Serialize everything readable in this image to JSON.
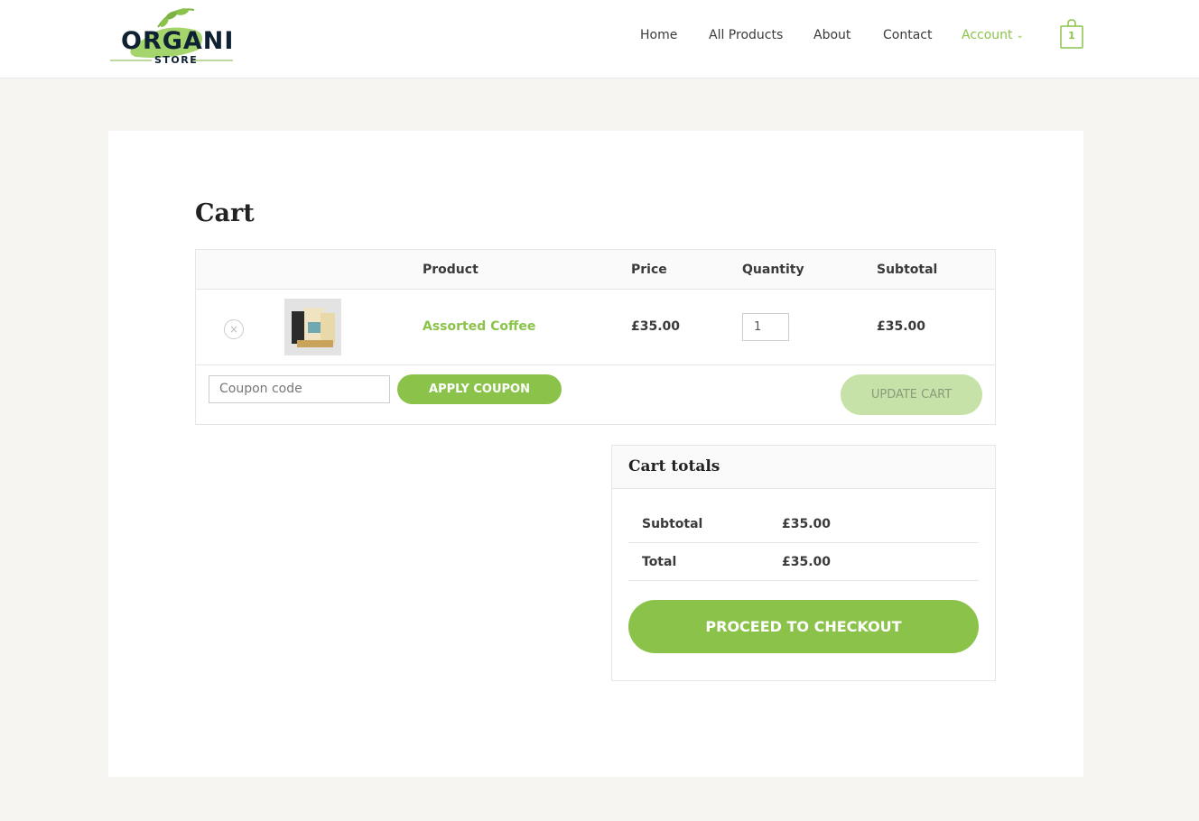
{
  "logo": {
    "top_text": "ORGANIC",
    "bottom_text": "STORE"
  },
  "nav": {
    "items": [
      {
        "label": "Home"
      },
      {
        "label": "All Products"
      },
      {
        "label": "About"
      },
      {
        "label": "Contact"
      },
      {
        "label": "Account",
        "active": true
      }
    ],
    "cart_count": "1"
  },
  "page": {
    "title": "Cart"
  },
  "cart_table": {
    "headers": [
      "Product",
      "Price",
      "Quantity",
      "Subtotal"
    ],
    "rows": [
      {
        "remove_icon": "×",
        "product_name": "Assorted Coffee",
        "price": "£35.00",
        "quantity": "1",
        "subtotal": "£35.00"
      }
    ],
    "coupon_placeholder": "Coupon code",
    "apply_coupon_label": "APPLY COUPON",
    "update_cart_label": "UPDATE CART"
  },
  "cart_totals": {
    "title": "Cart totals",
    "rows": [
      {
        "label": "Subtotal",
        "value": "£35.00"
      },
      {
        "label": "Total",
        "value": "£35.00"
      }
    ],
    "checkout_label": "PROCEED TO CHECKOUT"
  },
  "colors": {
    "accent": "#8bc34a",
    "accent_light": "#c7e2a9",
    "background": "#f6f5f1"
  }
}
